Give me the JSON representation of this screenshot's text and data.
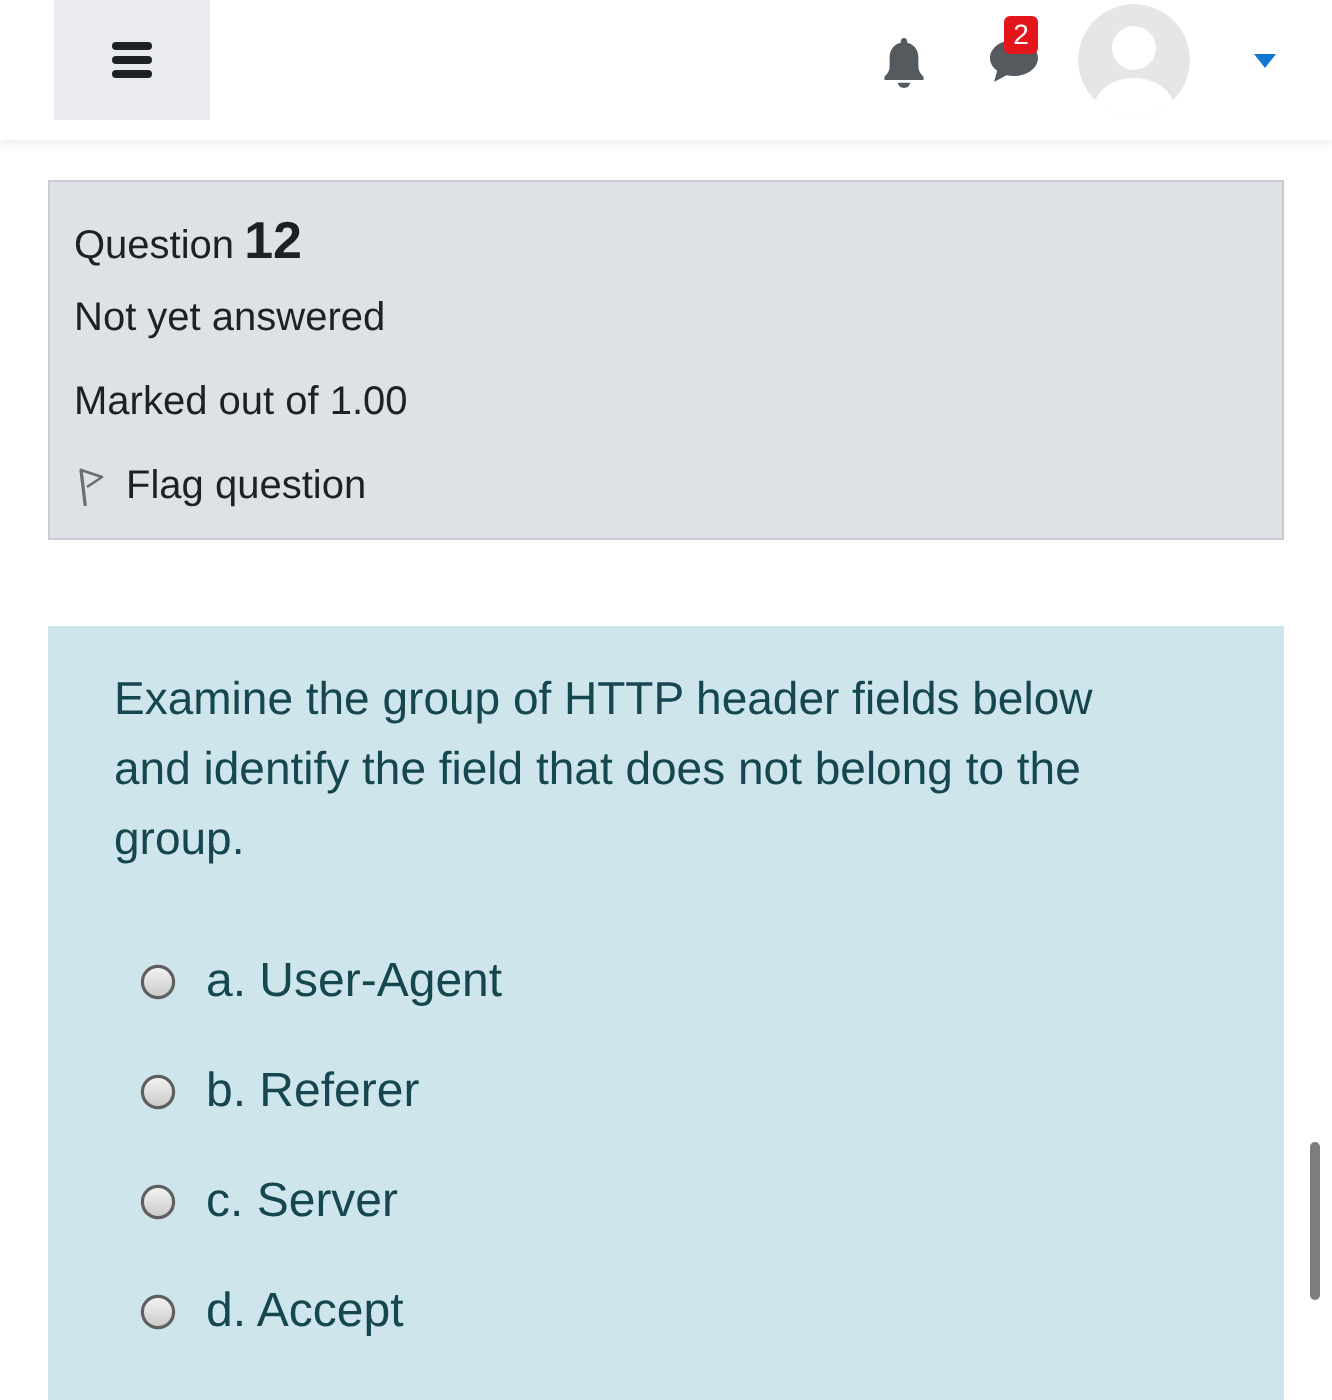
{
  "header": {
    "message_badge": "2"
  },
  "question_info": {
    "label": "Question",
    "number": "12",
    "status": "Not yet answered",
    "marks": "Marked out of 1.00",
    "flag": {
      "label": "Flag question",
      "flagged": false
    }
  },
  "question": {
    "text": "Examine the group of HTTP header fields below and identify the field that does not belong to the group.",
    "options": [
      {
        "label": "a. User-Agent",
        "selected": false
      },
      {
        "label": "b. Referer",
        "selected": false
      },
      {
        "label": "c. Server",
        "selected": false
      },
      {
        "label": "d. Accept",
        "selected": false
      }
    ]
  }
}
